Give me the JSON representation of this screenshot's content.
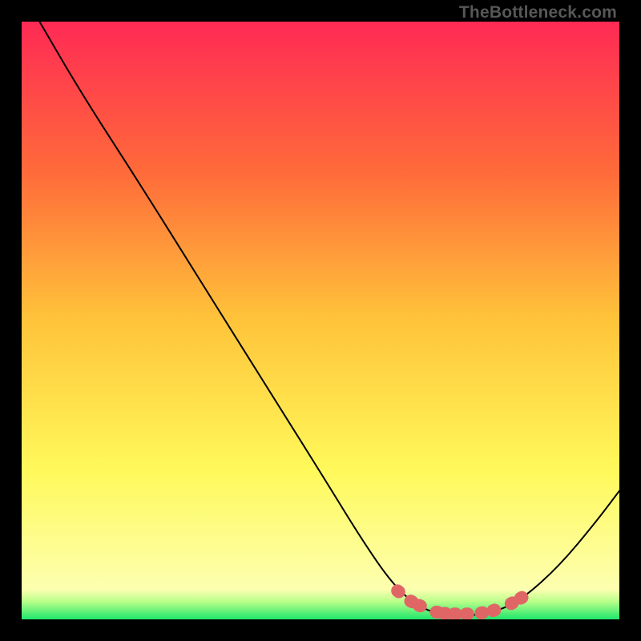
{
  "attribution": "TheBottleneck.com",
  "chart_data": {
    "type": "line",
    "title": "",
    "xlabel": "",
    "ylabel": "",
    "xlim": [
      0,
      100
    ],
    "ylim": [
      0,
      100
    ],
    "gradient_stops": [
      {
        "offset": 0,
        "color": "#ff2a55"
      },
      {
        "offset": 25,
        "color": "#ff6a3a"
      },
      {
        "offset": 50,
        "color": "#ffc43a"
      },
      {
        "offset": 75,
        "color": "#fff95a"
      },
      {
        "offset": 95,
        "color": "#fdffb0"
      },
      {
        "offset": 97,
        "color": "#b9ff8a"
      },
      {
        "offset": 100,
        "color": "#1ee66b"
      }
    ],
    "series": [
      {
        "name": "bottleneck-curve",
        "color": "#000000",
        "stroke_width": 2,
        "points": [
          {
            "x": 3.0,
            "y": 100.0
          },
          {
            "x": 10.0,
            "y": 88.0
          },
          {
            "x": 20.0,
            "y": 72.5
          },
          {
            "x": 30.0,
            "y": 56.5
          },
          {
            "x": 40.0,
            "y": 40.5
          },
          {
            "x": 50.0,
            "y": 24.6
          },
          {
            "x": 57.0,
            "y": 13.2
          },
          {
            "x": 62.0,
            "y": 6.0
          },
          {
            "x": 66.0,
            "y": 2.3
          },
          {
            "x": 70.0,
            "y": 0.8
          },
          {
            "x": 75.0,
            "y": 0.5
          },
          {
            "x": 80.0,
            "y": 1.5
          },
          {
            "x": 84.0,
            "y": 3.6
          },
          {
            "x": 90.0,
            "y": 9.0
          },
          {
            "x": 96.0,
            "y": 16.2
          },
          {
            "x": 100.0,
            "y": 21.5
          }
        ]
      }
    ],
    "highlight": [
      {
        "x": 63.0,
        "y": 4.7
      },
      {
        "x": 65.2,
        "y": 3.0
      },
      {
        "x": 66.6,
        "y": 2.3
      },
      {
        "x": 69.5,
        "y": 1.2
      },
      {
        "x": 70.8,
        "y": 1.0
      },
      {
        "x": 72.5,
        "y": 0.9
      },
      {
        "x": 74.5,
        "y": 0.9
      },
      {
        "x": 77.0,
        "y": 1.1
      },
      {
        "x": 79.0,
        "y": 1.5
      },
      {
        "x": 82.0,
        "y": 2.7
      },
      {
        "x": 83.6,
        "y": 3.6
      }
    ],
    "highlight_style": {
      "color": "#e06666",
      "radius": 8
    }
  }
}
